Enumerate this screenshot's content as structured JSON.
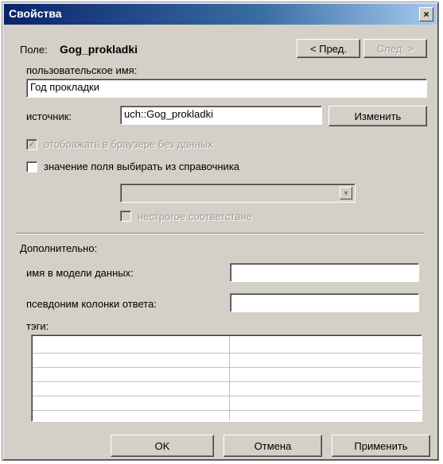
{
  "window": {
    "title": "Свойства",
    "close_glyph": "×"
  },
  "field": {
    "label": "Поле:",
    "name": "Gog_prokladki"
  },
  "nav": {
    "prev_label": "< Пред.",
    "next_label": "След. >"
  },
  "user_name": {
    "label": "пользовательское имя:",
    "value": "Год прокладки"
  },
  "source": {
    "label": "источник:",
    "value": "uch::Gog_prokladki",
    "change_label": "Изменить"
  },
  "options": {
    "show_in_browser_label": "отображать в браузере без данных",
    "show_in_browser_checked": "✓",
    "from_reference_label": "значение поля выбирать из справочника",
    "fuzzy_match_label": "нестрогое соответствие",
    "dropdown_glyph": "▼"
  },
  "extra": {
    "section_label": "Дополнительно:",
    "model_name_label": "имя в модели данных:",
    "model_name_value": "",
    "alias_label": "псевдоним колонки ответа:",
    "alias_value": "",
    "tags_label": "тэги:"
  },
  "buttons": {
    "ok": "OK",
    "cancel": "Отмена",
    "apply": "Применить"
  }
}
